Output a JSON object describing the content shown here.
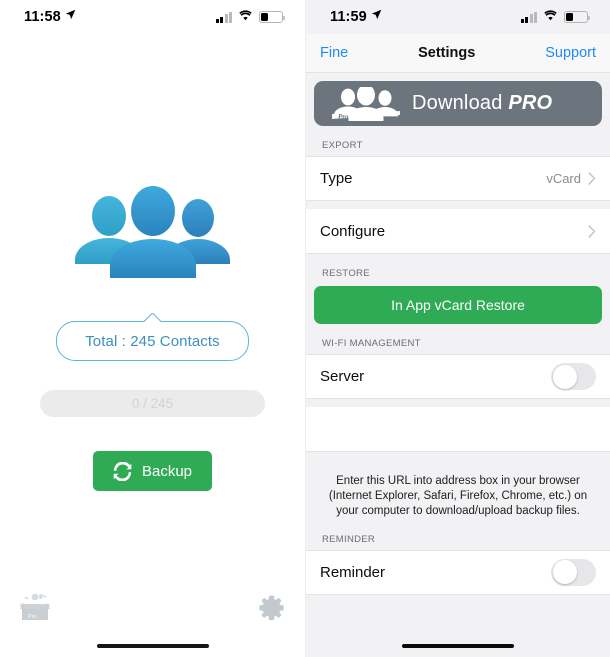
{
  "left_screen": {
    "status_bar": {
      "time": "11:58",
      "location_icon": "location-arrow-icon",
      "signal_icon": "cellular-signal-icon",
      "wifi_icon": "wifi-icon",
      "battery_icon": "battery-low-icon"
    },
    "contacts_illustration": "three-people-icon",
    "total_label": "Total : 245 Contacts",
    "progress": {
      "text": "0 / 245",
      "value": 0,
      "max": 245
    },
    "backup_button": {
      "label": "Backup",
      "icon": "refresh-icon",
      "color": "#2fab55"
    },
    "footer": {
      "restore_icon": "open-box-icon",
      "settings_icon": "gear-icon"
    }
  },
  "right_screen": {
    "status_bar": {
      "time": "11:59",
      "location_icon": "location-arrow-icon",
      "signal_icon": "cellular-signal-icon",
      "wifi_icon": "wifi-icon",
      "battery_icon": "battery-low-icon"
    },
    "navbar": {
      "back_label": "Fine",
      "title": "Settings",
      "action_label": "Support"
    },
    "promo_banner": {
      "text_main": "Download ",
      "text_em": "PRO",
      "badge": "Pro",
      "icon": "three-people-white-icon",
      "color": "#6c757d"
    },
    "sections": [
      {
        "header": "EXPORT",
        "rows": [
          {
            "label": "Type",
            "value": "vCard",
            "accessory": "chevron-right-icon"
          },
          {
            "label": "Configure",
            "value": "",
            "accessory": "chevron-right-icon"
          }
        ]
      },
      {
        "header": "RESTORE",
        "button": {
          "label": "In App vCard Restore",
          "color": "#2fab55"
        }
      },
      {
        "header": "WI-FI MANAGEMENT",
        "rows": [
          {
            "label": "Server",
            "toggle": "off"
          }
        ],
        "help_text": "Enter this URL into address box in your browser (Internet Explorer, Safari, Firefox, Chrome, etc.) on your computer to download/upload backup files."
      },
      {
        "header": "REMINDER",
        "rows": [
          {
            "label": "Reminder",
            "toggle": "off"
          }
        ]
      }
    ]
  }
}
